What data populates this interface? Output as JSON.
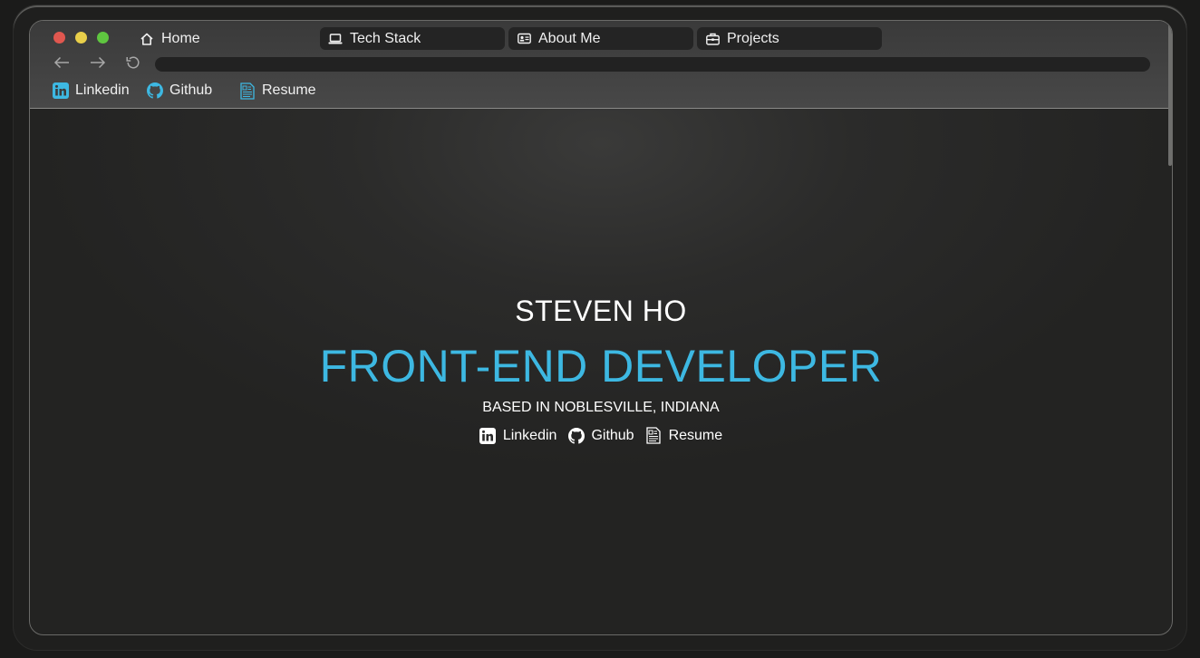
{
  "browser": {
    "tabs": [
      {
        "label": "Home",
        "icon": "home-icon"
      },
      {
        "label": "Tech Stack",
        "icon": "laptop-icon"
      },
      {
        "label": "About Me",
        "icon": "id-card-icon"
      },
      {
        "label": "Projects",
        "icon": "briefcase-icon"
      }
    ],
    "nav": {
      "back_icon": "arrow-left-icon",
      "forward_icon": "arrow-right-icon",
      "reload_icon": "reload-icon"
    },
    "url": "",
    "bookmarks": [
      {
        "label": "Linkedin",
        "icon": "linkedin-icon"
      },
      {
        "label": "Github",
        "icon": "github-icon"
      },
      {
        "label": "Resume",
        "icon": "resume-icon"
      }
    ]
  },
  "hero": {
    "name": "STEVEN HO",
    "role": "FRONT-END DEVELOPER",
    "location": "BASED IN NOBLESVILLE, INDIANA",
    "links": [
      {
        "label": "Linkedin",
        "icon": "linkedin-icon"
      },
      {
        "label": "Github",
        "icon": "github-icon"
      },
      {
        "label": "Resume",
        "icon": "resume-icon"
      }
    ]
  },
  "colors": {
    "accent": "#3db8e2",
    "text": "#ffffff",
    "background": "#2b2b2a"
  }
}
